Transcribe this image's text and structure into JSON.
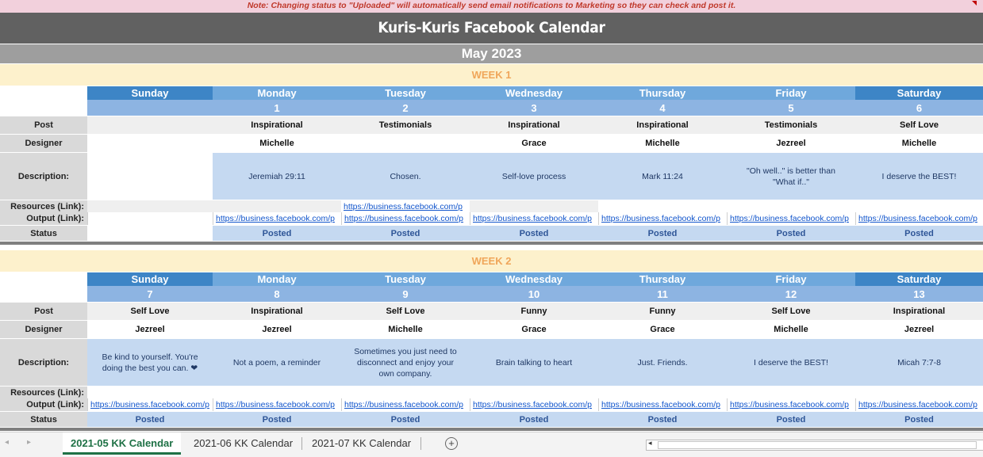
{
  "note": "Note: Changing status to \"Uploaded\" will automatically send email notifications to Marketing so they can check and post it.",
  "title": "Kuris-Kuris Facebook Calendar",
  "month": "May 2023",
  "labels": {
    "post": "Post",
    "designer": "Designer",
    "description": "Description:",
    "resources": "Resources (Link):",
    "output": "Output (Link):",
    "status": "Status"
  },
  "day_names": [
    "Sunday",
    "Monday",
    "Tuesday",
    "Wednesday",
    "Thursday",
    "Friday",
    "Saturday"
  ],
  "link_text": "https://business.facebook.com/p",
  "week1": {
    "label": "WEEK 1",
    "days": [
      {
        "num": "",
        "post": "",
        "designer": "",
        "desc": "",
        "resource": "",
        "output": "",
        "status": ""
      },
      {
        "num": "1",
        "post": "Inspirational",
        "designer": "Michelle",
        "desc": "Jeremiah 29:11",
        "resource": "",
        "output": "https://business.facebook.com/p",
        "status": "Posted"
      },
      {
        "num": "2",
        "post": "Testimonials",
        "designer": "",
        "desc": "Chosen.",
        "resource": "https://business.facebook.com/p",
        "output": "https://business.facebook.com/p",
        "status": "Posted"
      },
      {
        "num": "3",
        "post": "Inspirational",
        "designer": "Grace",
        "desc": "Self-love process",
        "resource": "",
        "output": "https://business.facebook.com/p",
        "status": "Posted"
      },
      {
        "num": "4",
        "post": "Inspirational",
        "designer": "Michelle",
        "desc": "Mark 11:24",
        "resource": "",
        "output": "https://business.facebook.com/p",
        "status": "Posted"
      },
      {
        "num": "5",
        "post": "Testimonials",
        "designer": "Jezreel",
        "desc": "\"Oh well..\" is better than \"What if..\"",
        "resource": "",
        "output": "https://business.facebook.com/p",
        "status": "Posted"
      },
      {
        "num": "6",
        "post": "Self Love",
        "designer": "Michelle",
        "desc": "I deserve the BEST!",
        "resource": "",
        "output": "https://business.facebook.com/p",
        "status": "Posted"
      }
    ]
  },
  "week2": {
    "label": "WEEK 2",
    "days": [
      {
        "num": "7",
        "post": "Self Love",
        "designer": "Jezreel",
        "desc": "Be kind to yourself. You're doing the best you can. ❤",
        "resource": "",
        "output": "https://business.facebook.com/p",
        "status": "Posted"
      },
      {
        "num": "8",
        "post": "Inspirational",
        "designer": "Jezreel",
        "desc": "Not a poem, a reminder",
        "resource": "",
        "output": "https://business.facebook.com/p",
        "status": "Posted"
      },
      {
        "num": "9",
        "post": "Self Love",
        "designer": "Michelle",
        "desc": "Sometimes you just need to disconnect and enjoy your own company.",
        "resource": "",
        "output": "https://business.facebook.com/p",
        "status": "Posted"
      },
      {
        "num": "10",
        "post": "Funny",
        "designer": "Grace",
        "desc": "Brain talking to heart",
        "resource": "",
        "output": "https://business.facebook.com/p",
        "status": "Posted"
      },
      {
        "num": "11",
        "post": "Funny",
        "designer": "Grace",
        "desc": "Just. Friends.",
        "resource": "",
        "output": "https://business.facebook.com/p",
        "status": "Posted"
      },
      {
        "num": "12",
        "post": "Self Love",
        "designer": "Michelle",
        "desc": "I deserve the BEST!",
        "resource": "",
        "output": "https://business.facebook.com/p",
        "status": "Posted"
      },
      {
        "num": "13",
        "post": "Inspirational",
        "designer": "Jezreel",
        "desc": "Micah 7:7-8",
        "resource": "",
        "output": "https://business.facebook.com/p",
        "status": "Posted"
      }
    ]
  },
  "colors": {
    "day_header_dark": "#3d85c6",
    "day_header_light": "#6fa8dc",
    "day_number": "#8db4e2",
    "week_band": "#fdf1cc",
    "description_fill": "#c5d9f1"
  },
  "tabs": [
    "2021-05 KK Calendar",
    "2021-06 KK Calendar",
    "2021-07 KK Calendar"
  ],
  "active_tab": "2021-05 KK Calendar",
  "icons": {
    "prev_sheet": "◂",
    "next_sheet": "▸",
    "add_sheet": "+",
    "scroll_left": "◂"
  }
}
